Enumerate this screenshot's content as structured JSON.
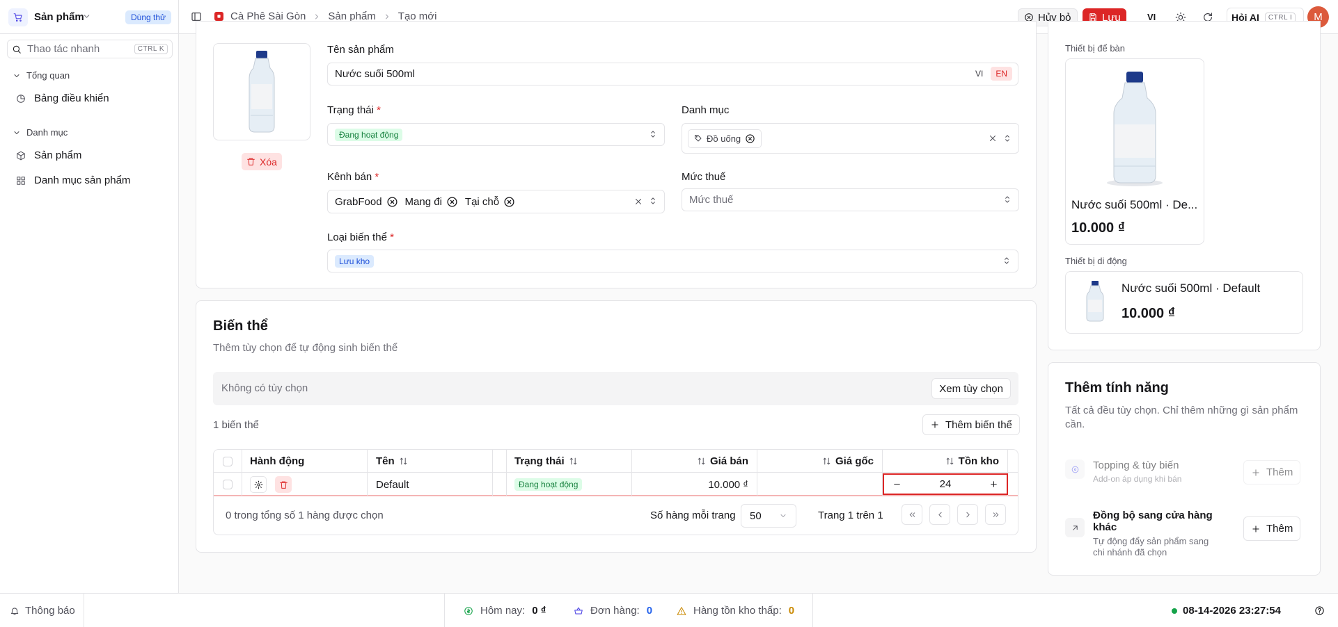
{
  "header": {
    "app_name": "Sản phẩm",
    "trial": "Dùng thử",
    "breadcrumb": [
      "Cà Phê Sài Gòn",
      "Sản phẩm",
      "Tạo mới"
    ],
    "cancel": "Hủy bỏ",
    "save": "Lưu",
    "lang": "VI",
    "ask_ai": "Hỏi AI",
    "ask_ai_kbd": "CTRL I",
    "avatar": "M"
  },
  "sidebar": {
    "quick_action": "Thao tác nhanh",
    "quick_kbd": "CTRL K",
    "group1": "Tổng quan",
    "dashboard": "Bảng điều khiển",
    "group2": "Danh mục",
    "products": "Sản phẩm",
    "categories": "Danh mục sản phẩm"
  },
  "form": {
    "delete_image": "Xóa",
    "name_label": "Tên sản phẩm",
    "name_value": "Nước suối 500ml",
    "lang_vi": "VI",
    "lang_en": "EN",
    "status_label": "Trạng thái",
    "status_value": "Đang hoạt động",
    "category_label": "Danh mục",
    "category_value": "Đồ uống",
    "channel_label": "Kênh bán",
    "channels": [
      "GrabFood",
      "Mang đi",
      "Tại chỗ"
    ],
    "tax_label": "Mức thuế",
    "tax_placeholder": "Mức thuế",
    "variant_type_label": "Loại biến thể",
    "variant_type_value": "Lưu kho",
    "required_mark": "*"
  },
  "variants": {
    "title": "Biến thể",
    "subtitle": "Thêm tùy chọn để tự động sinh biến thể",
    "no_options": "Không có tùy chọn",
    "view_options": "Xem tùy chọn",
    "count": "1 biến thể",
    "add_variant": "Thêm biến thể",
    "columns": {
      "action": "Hành động",
      "name": "Tên",
      "status": "Trạng thái",
      "price": "Giá bán",
      "cost": "Giá gốc",
      "stock": "Tồn kho"
    },
    "row": {
      "name": "Default",
      "status": "Đang hoạt động",
      "price": "10.000 ₫",
      "cost": "",
      "stock": "24"
    },
    "selected_info": "0 trong tổng số 1 hàng được chọn",
    "rows_per_page_label": "Số hàng mỗi trang",
    "rows_per_page": "50",
    "page_info": "Trang 1 trên 1"
  },
  "preview": {
    "desktop_label": "Thiết bị để bàn",
    "desktop_title": "Nước suối 500ml · De...",
    "desktop_price": "10.000 ₫",
    "mobile_label": "Thiết bị di động",
    "mobile_title": "Nước suối 500ml · Default",
    "mobile_price": "10.000 ₫"
  },
  "features": {
    "title": "Thêm tính năng",
    "subtitle": "Tất cả đều tùy chọn. Chỉ thêm những gì sản phẩm cần.",
    "items": [
      {
        "title": "Topping & tùy biến",
        "desc": "Add-on áp dụng khi bán",
        "button": "Thêm"
      },
      {
        "title": "Đồng bộ sang cửa hàng khác",
        "desc": "Tự động đẩy sản phẩm sang chi nhánh đã chọn",
        "button": "Thêm"
      }
    ]
  },
  "footer": {
    "notifications": "Thông báo",
    "today_label": "Hôm nay:",
    "today_value": "0 ₫",
    "orders_label": "Đơn hàng:",
    "orders_value": "0",
    "low_stock_label": "Hàng tồn kho thấp:",
    "low_stock_value": "0",
    "datetime": "08-14-2026 23:27:54"
  },
  "colors": {
    "accent": "#dc2626",
    "success": "#15803d",
    "info": "#1d4ed8",
    "warning": "#ca8a04"
  }
}
